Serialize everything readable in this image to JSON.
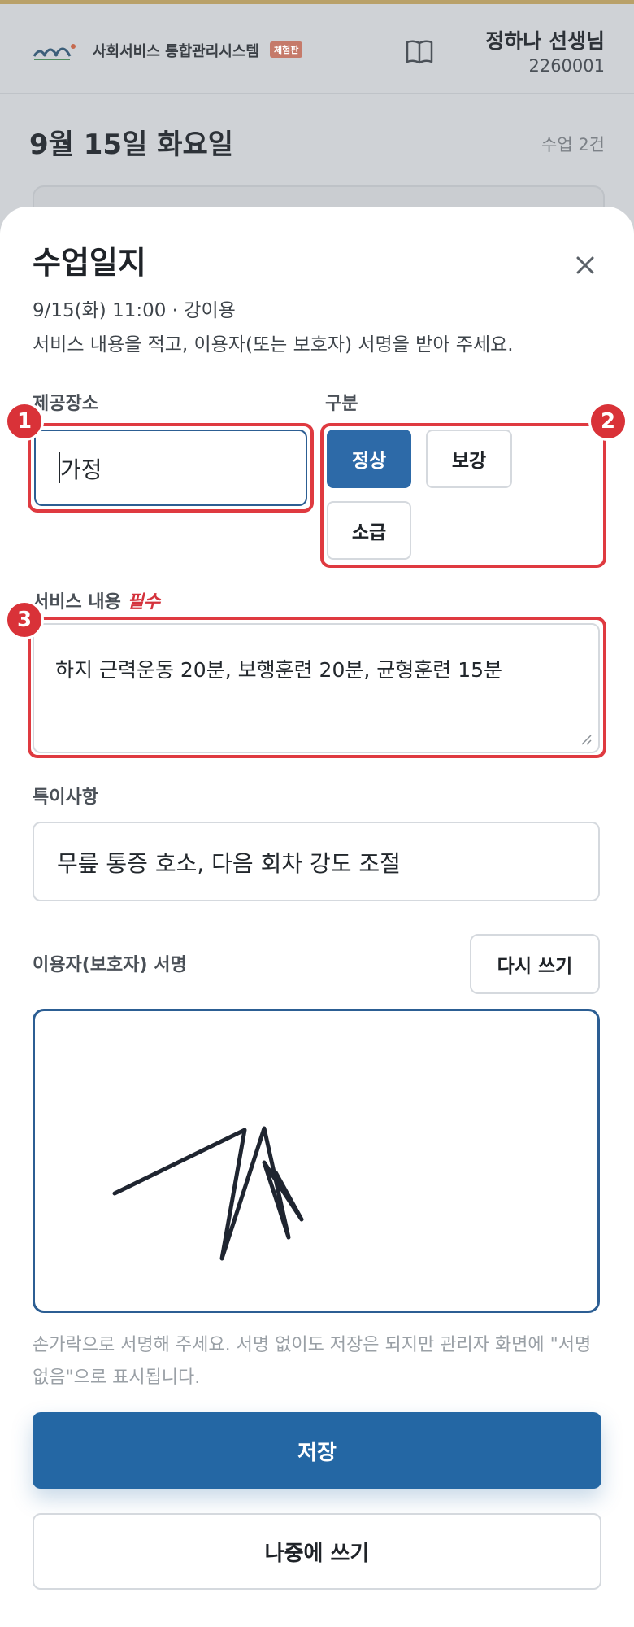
{
  "header": {
    "app_name": "사회서비스 통합관리시스템",
    "badge": "체험판",
    "user_name": "정하나 선생님",
    "user_id": "2260001"
  },
  "background": {
    "date_title": "9월 15일 화요일",
    "lesson_count": "수업 2건"
  },
  "sheet": {
    "title": "수업일지",
    "meta": "9/15(화) 11:00 · 강이용",
    "instructions": "서비스 내용을 적고, 이용자(또는 보호자) 서명을 받아 주세요.",
    "place_label": "제공장소",
    "place_value": "가정",
    "type_label": "구분",
    "type_options": [
      "정상",
      "보강",
      "소급"
    ],
    "type_selected": "정상",
    "service_label": "서비스 내용",
    "service_required": "필수",
    "service_value": "하지 근력운동 20분, 보행훈련 20분, 균형훈련 15분",
    "notes_label": "특이사항",
    "notes_value": "무릎 통증 호소, 다음 회차 강도 조절",
    "signature_label": "이용자(보호자) 서명",
    "rewrite_label": "다시 쓰기",
    "signature_hint": "손가락으로 서명해 주세요. 서명 없이도 저장은 되지만 관리자 화면에 \"서명 없음\"으로 표시됩니다.",
    "save_label": "저장",
    "later_label": "나중에 쓰기"
  },
  "annotations": [
    "1",
    "2",
    "3"
  ],
  "colors": {
    "primary": "#2467a4",
    "highlight": "#df3a40",
    "required": "#d4323c"
  }
}
